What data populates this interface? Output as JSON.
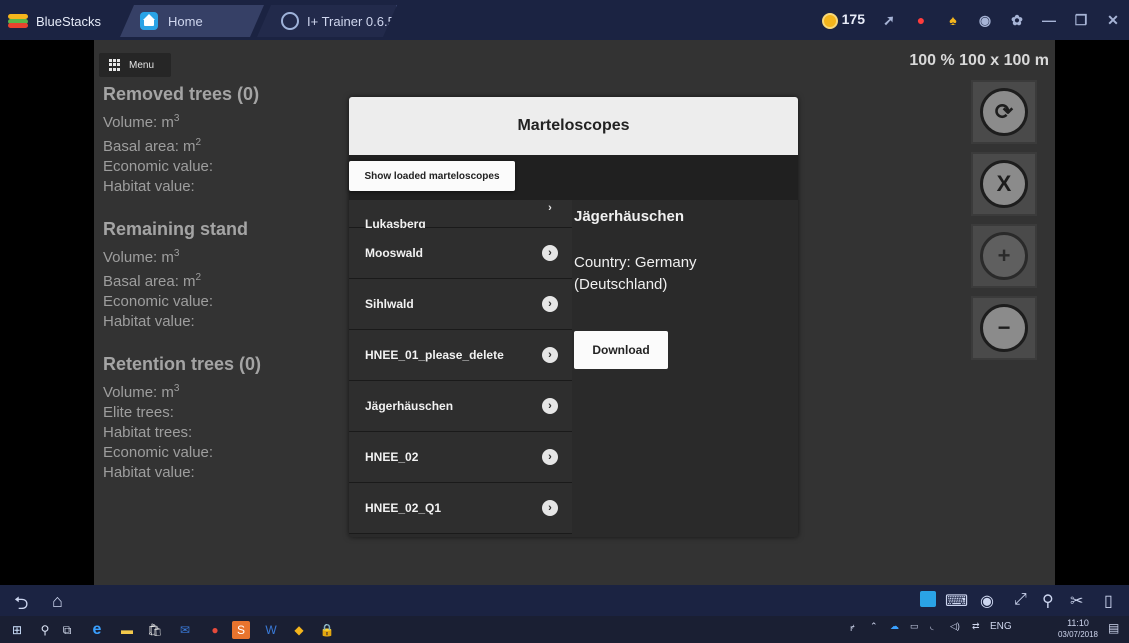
{
  "window": {
    "tabs": [
      {
        "label": "BlueStacks"
      },
      {
        "label": "Home"
      },
      {
        "label": "I+ Trainer 0.6.5"
      }
    ],
    "coins": "175"
  },
  "app": {
    "menu_label": "Menu",
    "scale_label": "100 % 100 x 100 m",
    "removed": {
      "title": "Removed trees (0)",
      "volume": "Volume: m",
      "volume_unit_sup": "3",
      "basal": "Basal area: m",
      "basal_unit_sup": "2",
      "economic": "Economic value:",
      "habitat": "Habitat value:"
    },
    "remaining": {
      "title": "Remaining stand",
      "volume": "Volume: m",
      "volume_unit_sup": "3",
      "basal": "Basal area: m",
      "basal_unit_sup": "2",
      "economic": "Economic value:",
      "habitat": "Habitat value:"
    },
    "retention": {
      "title": "Retention trees (0)",
      "volume": "Volume: m",
      "volume_unit_sup": "3",
      "elite": "Elite trees:",
      "habitat_trees": "Habitat trees:",
      "economic": "Economic value:",
      "habitat": "Habitat value:"
    }
  },
  "dialog": {
    "title": "Marteloscopes",
    "show_loaded_label": "Show loaded marteloscopes",
    "partial_item": "Lukasberg",
    "items": [
      {
        "label": "Mooswald"
      },
      {
        "label": "Sihlwald"
      },
      {
        "label": "HNEE_01_please_delete"
      },
      {
        "label": "Jägerhäuschen"
      },
      {
        "label": "HNEE_02"
      },
      {
        "label": "HNEE_02_Q1"
      }
    ],
    "detail": {
      "name": "Jägerhäuschen",
      "country": "Country: Germany (Deutschland)",
      "download_label": "Download"
    }
  },
  "taskbar": {
    "lang": "ENG",
    "time": "11:10",
    "date": "03/07/2018"
  }
}
